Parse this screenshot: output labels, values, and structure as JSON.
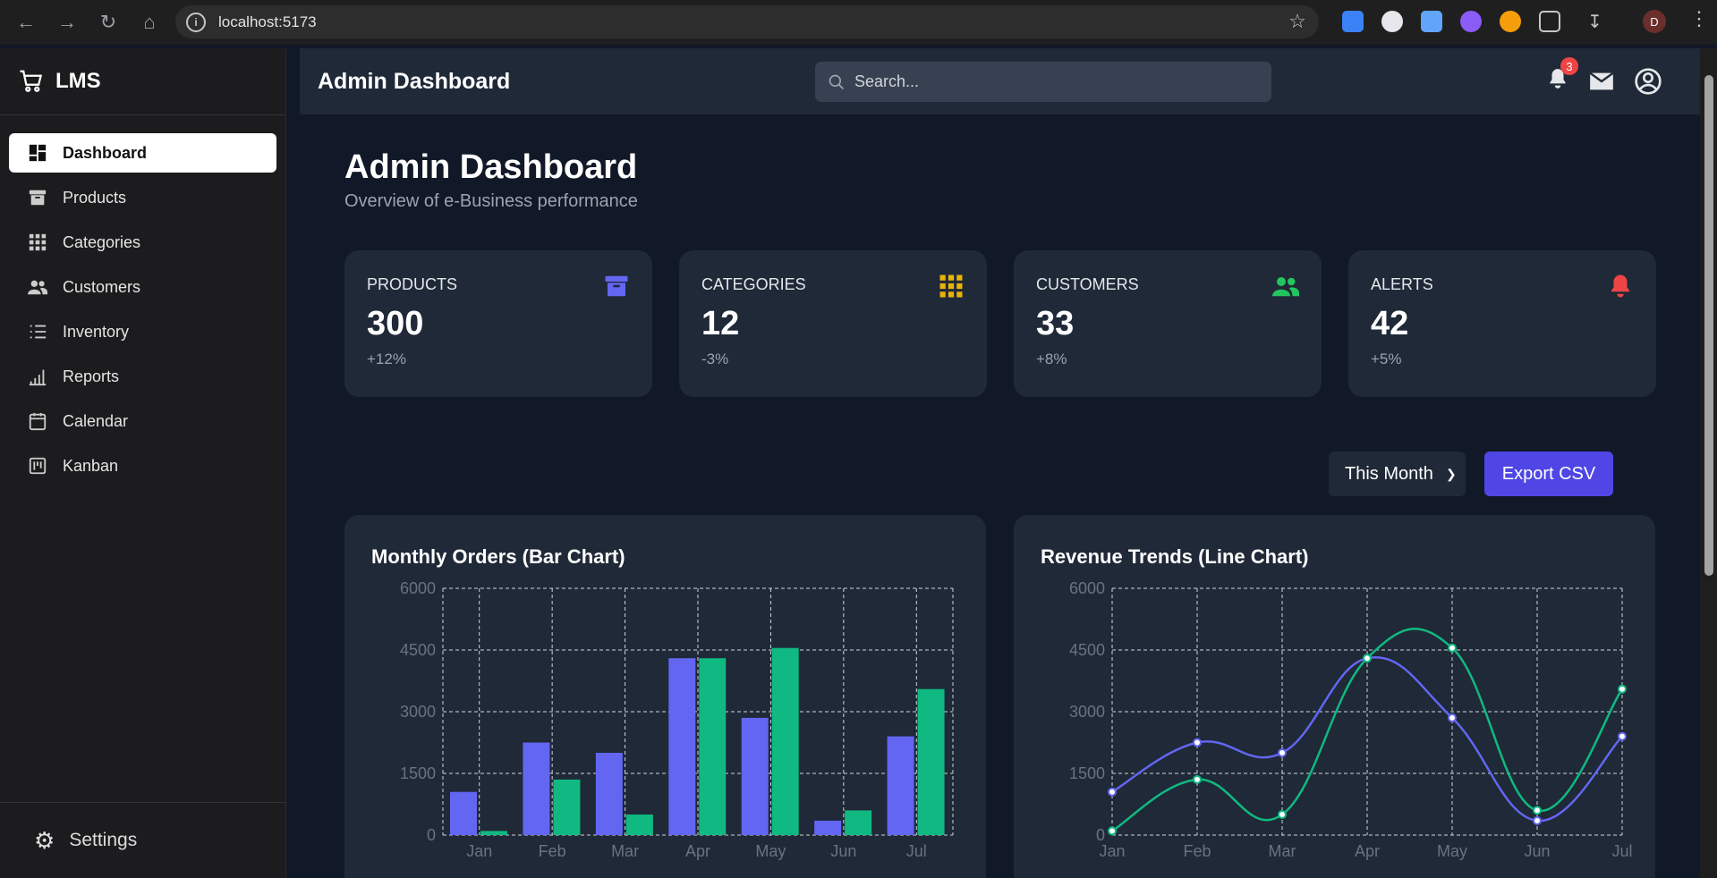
{
  "browser": {
    "url": "localhost:5173",
    "profile_initial": "D"
  },
  "sidebar": {
    "brand": "LMS",
    "items": [
      {
        "label": "Dashboard",
        "icon": "dashboard-icon",
        "active": true
      },
      {
        "label": "Products",
        "icon": "archive-icon"
      },
      {
        "label": "Categories",
        "icon": "grid-icon"
      },
      {
        "label": "Customers",
        "icon": "users-icon"
      },
      {
        "label": "Inventory",
        "icon": "list-icon"
      },
      {
        "label": "Reports",
        "icon": "bar-chart-icon"
      },
      {
        "label": "Calendar",
        "icon": "calendar-icon"
      },
      {
        "label": "Kanban",
        "icon": "kanban-icon"
      }
    ],
    "settings_label": "Settings"
  },
  "topbar": {
    "title": "Admin Dashboard",
    "search_placeholder": "Search...",
    "notification_count": "3"
  },
  "main": {
    "title": "Admin Dashboard",
    "subtitle": "Overview of e-Business performance",
    "cards": [
      {
        "label": "PRODUCTS",
        "value": "300",
        "change": "+12%",
        "icon": "archive-icon",
        "color": "#6366f1"
      },
      {
        "label": "CATEGORIES",
        "value": "12",
        "change": "-3%",
        "icon": "grid-icon",
        "color": "#eab308"
      },
      {
        "label": "CUSTOMERS",
        "value": "33",
        "change": "+8%",
        "icon": "users-icon",
        "color": "#22c55e"
      },
      {
        "label": "ALERTS",
        "value": "42",
        "change": "+5%",
        "icon": "bell-icon",
        "color": "#ef4444"
      }
    ],
    "period_select": "This Month",
    "export_label": "Export CSV"
  },
  "chart_data": [
    {
      "type": "bar",
      "title": "Monthly Orders (Bar Chart)",
      "categories": [
        "Jan",
        "Feb",
        "Mar",
        "Apr",
        "May",
        "Jun",
        "Jul"
      ],
      "series": [
        {
          "color": "#6366f1",
          "values": [
            1050,
            2250,
            2000,
            4300,
            2850,
            350,
            2400
          ]
        },
        {
          "color": "#10b981",
          "values": [
            100,
            1350,
            500,
            4300,
            4550,
            600,
            3550
          ]
        }
      ],
      "yticks": [
        0,
        1500,
        3000,
        4500,
        6000
      ],
      "ylim": [
        0,
        6000
      ]
    },
    {
      "type": "line",
      "title": "Revenue Trends (Line Chart)",
      "categories": [
        "Jan",
        "Feb",
        "Mar",
        "Apr",
        "May",
        "Jun",
        "Jul"
      ],
      "series": [
        {
          "color": "#6366f1",
          "values": [
            1050,
            2250,
            2000,
            4300,
            2850,
            350,
            2400
          ]
        },
        {
          "color": "#10b981",
          "values": [
            100,
            1350,
            500,
            4300,
            4550,
            600,
            3550
          ]
        }
      ],
      "yticks": [
        0,
        1500,
        3000,
        4500,
        6000
      ],
      "ylim": [
        0,
        6000
      ]
    }
  ]
}
